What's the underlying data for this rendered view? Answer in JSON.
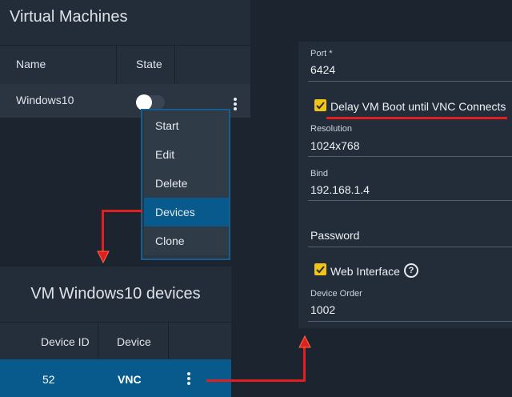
{
  "vm_list": {
    "title": "Virtual Machines",
    "columns": [
      "Name",
      "State"
    ],
    "rows": [
      {
        "name": "Windows10"
      }
    ]
  },
  "context_menu": {
    "items": [
      {
        "label": "Start",
        "active": false
      },
      {
        "label": "Edit",
        "active": false
      },
      {
        "label": "Delete",
        "active": false
      },
      {
        "label": "Devices",
        "active": true
      },
      {
        "label": "Clone",
        "active": false
      }
    ]
  },
  "devices": {
    "title": "VM Windows10 devices",
    "columns": [
      "Device ID",
      "Device"
    ],
    "rows": [
      {
        "id": "52",
        "device": "VNC"
      }
    ]
  },
  "form": {
    "port": {
      "label": "Port *",
      "value": "6424"
    },
    "delay_boot": {
      "label": "Delay VM Boot until VNC Connects",
      "checked": true
    },
    "resolution": {
      "label": "Resolution",
      "value": "1024x768"
    },
    "bind": {
      "label": "Bind",
      "value": "192.168.1.4"
    },
    "password": {
      "placeholder": "Password"
    },
    "web_interface": {
      "label": "Web Interface",
      "checked": true,
      "help": "?"
    },
    "device_order": {
      "label": "Device Order",
      "value": "1002"
    }
  },
  "colors": {
    "accent": "#085a8c",
    "checkbox": "#f0c419",
    "annotation": "#e02020"
  }
}
